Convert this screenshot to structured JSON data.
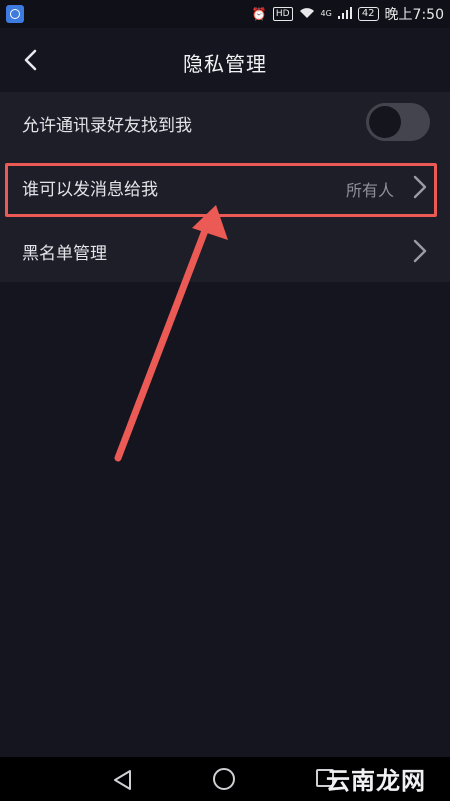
{
  "status_bar": {
    "hd": "HD",
    "network": "4G",
    "battery": "42",
    "time": "晚上7:50"
  },
  "header": {
    "title": "隐私管理"
  },
  "settings": [
    {
      "label": "允许通讯录好友找到我",
      "control": "toggle",
      "toggle_on": false
    },
    {
      "label": "谁可以发消息给我",
      "value": "所有人",
      "control": "chevron"
    },
    {
      "label": "黑名单管理",
      "control": "chevron"
    }
  ],
  "watermark": "云南龙网",
  "colors": {
    "background": "#15151f",
    "list_background": "#1d1e28",
    "annotation_red": "#ec5a55",
    "toggle_off": "#43444d"
  }
}
